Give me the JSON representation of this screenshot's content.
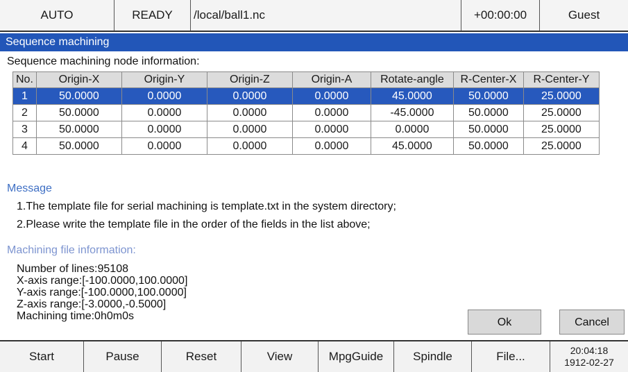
{
  "status_bar": {
    "mode": "AUTO",
    "state": "READY",
    "file_path": "/local/ball1.nc",
    "timer": "+00:00:00",
    "user": "Guest"
  },
  "title": "Sequence machining",
  "node_section_label": "Sequence machining node information:",
  "table": {
    "headers": [
      "No.",
      "Origin-X",
      "Origin-Y",
      "Origin-Z",
      "Origin-A",
      "Rotate-angle",
      "R-Center-X",
      "R-Center-Y"
    ],
    "selected_row": 0,
    "rows": [
      [
        "1",
        "50.0000",
        "0.0000",
        "0.0000",
        "0.0000",
        "45.0000",
        "50.0000",
        "25.0000"
      ],
      [
        "2",
        "50.0000",
        "0.0000",
        "0.0000",
        "0.0000",
        "-45.0000",
        "50.0000",
        "25.0000"
      ],
      [
        "3",
        "50.0000",
        "0.0000",
        "0.0000",
        "0.0000",
        "0.0000",
        "50.0000",
        "25.0000"
      ],
      [
        "4",
        "50.0000",
        "0.0000",
        "0.0000",
        "0.0000",
        "45.0000",
        "50.0000",
        "25.0000"
      ]
    ]
  },
  "message": {
    "heading": "Message",
    "line1": "1.The template file for serial machining is template.txt in the system directory;",
    "line2": "2.Please write the template file in the order of the fields in the list above;"
  },
  "file_info": {
    "heading": "Machining file information:",
    "lines": "Number of lines:95108",
    "x_range": "X-axis range:[-100.0000,100.0000]",
    "y_range": "Y-axis range:[-100.0000,100.0000]",
    "z_range": "Z-axis range:[-3.0000,-0.5000]",
    "time": "Machining time:0h0m0s"
  },
  "dialog": {
    "ok_label": "Ok",
    "cancel_label": "Cancel"
  },
  "function_bar": {
    "start": "Start",
    "pause": "Pause",
    "reset": "Reset",
    "view": "View",
    "mpg_guide": "MpgGuide",
    "spindle": "Spindle",
    "file": "File...",
    "clock_time": "20:04:18",
    "clock_date": "1912-02-27"
  }
}
